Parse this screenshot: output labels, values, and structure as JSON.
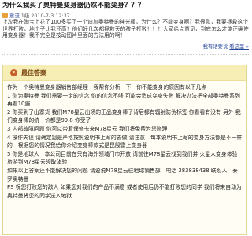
{
  "question": {
    "title": "为什么我买了奥特曼变身器仍然不能变身？？？",
    "asker": "意流",
    "asker_level": "1级",
    "date": "2010-7-3 12:37",
    "body": "上次我在淘宝上花了100多买了一个迪加奥特曼的神光棒，为什么？不能变身啊？我很急，我要拯救这个世界打败，地个子比我还高！他们好几次都拯救天的孩子打败！！！大家给点意见，到底怎么才能正确使用变身器！我不完全是按动图片里面的方法用的啊！",
    "report_label": "我有话要说",
    "report_link": "看这里 »"
  },
  "best_answer": {
    "label": "最佳答案",
    "paragraphs": [
      "作为一个奥特曼变身器销售部经理　我帮你分析一下　你不能变身的原因有以下几点",
      "1 你为奥特曼 我们需要一定的信念 你的信念不够 可能会造成变身失败 解决办法把全部奥特曼系列再看10遍",
      "2 你买到了山寨货 我们M78星云出场的正品变身棒子背后都有辐射防伪标签 你看看有没有 另外 我们变身棒的统一价都是99.8 你受了",
      "3 内部故障问题 你可以带着保修卡来M78星云 我们将免费为您修理",
      "4 操作失误 请确定您是严格按照说明书上写的去做 请注意　每本说明书上写的变身方法都是不一样的　根据您的情况我给你介绍变身棒款式是昆殷雷上变身器",
      "5 你是地球人　本公司目前在只有海外领域门市开放 请前往M78星云找到我们并 火星人变身体验旅游到M78星云领取体验",
      "如果以上答案还不能解决您的问题 请说说M78星云驻地球销售部　电话 383838438 联系人　泰罗奥特曼",
      "PS 祝您打败您的敌人 如果您对我们的产品不满意 或者使用后仍不能打败您的同学 我们将来自动为奥特曼将您的同学送入地狱"
    ]
  }
}
